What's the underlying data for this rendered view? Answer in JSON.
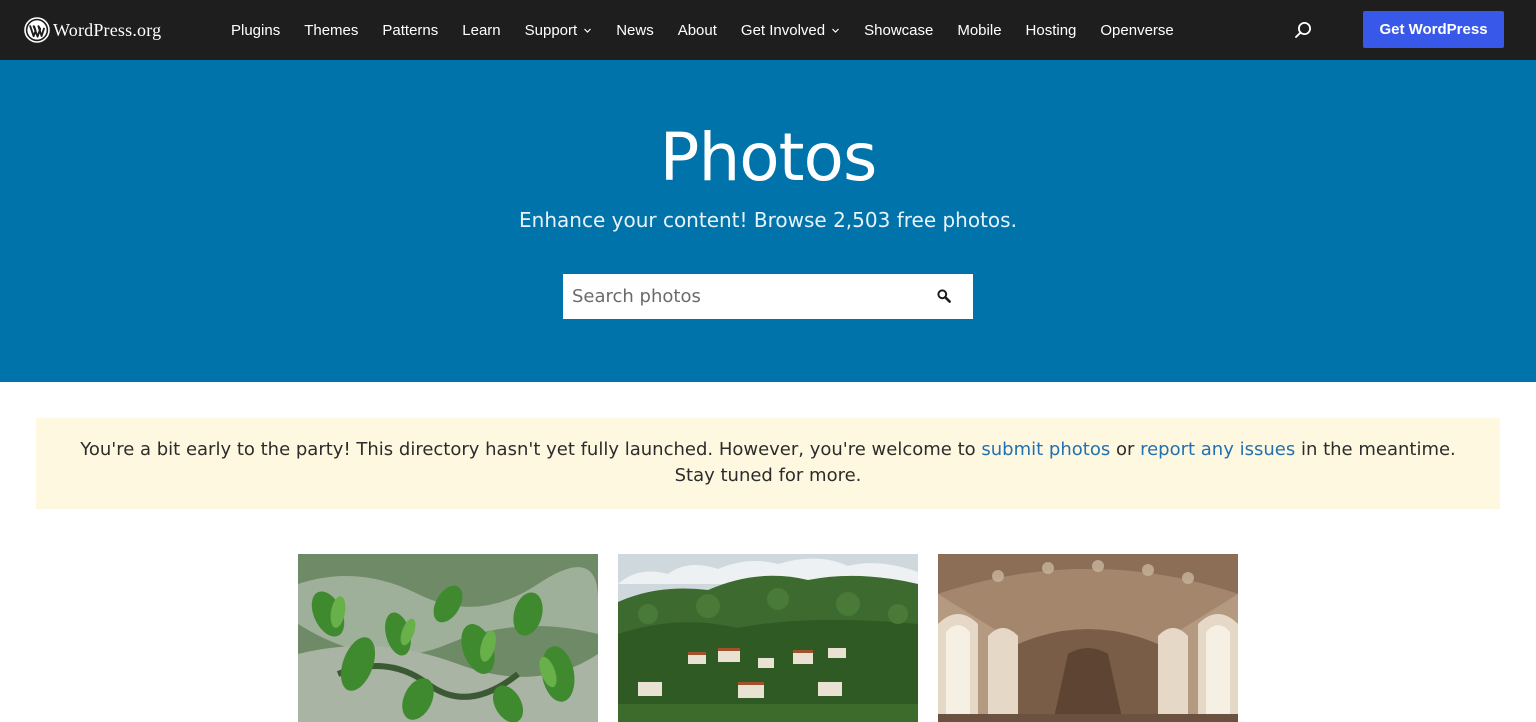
{
  "header": {
    "logo_text": "WordPress.org",
    "nav": [
      {
        "label": "Plugins",
        "dropdown": false
      },
      {
        "label": "Themes",
        "dropdown": false
      },
      {
        "label": "Patterns",
        "dropdown": false
      },
      {
        "label": "Learn",
        "dropdown": false
      },
      {
        "label": "Support",
        "dropdown": true
      },
      {
        "label": "News",
        "dropdown": false
      },
      {
        "label": "About",
        "dropdown": false
      },
      {
        "label": "Get Involved",
        "dropdown": true
      },
      {
        "label": "Showcase",
        "dropdown": false
      },
      {
        "label": "Mobile",
        "dropdown": false
      },
      {
        "label": "Hosting",
        "dropdown": false
      },
      {
        "label": "Openverse",
        "dropdown": false
      }
    ],
    "search_icon": "search-icon",
    "cta_label": "Get WordPress"
  },
  "hero": {
    "title": "Photos",
    "subtitle": "Enhance your content! Browse 2,503 free photos.",
    "search_placeholder": "Search photos",
    "search_value": ""
  },
  "notice": {
    "text_before": "You're a bit early to the party! This directory hasn't yet fully launched. However, you're welcome to ",
    "link1": "submit photos",
    "text_middle": " or ",
    "link2": "report any issues",
    "text_after": " in the meantime. Stay tuned for more."
  },
  "photos": [
    {
      "subject": "green plants in stream"
    },
    {
      "subject": "forested hillside with village"
    },
    {
      "subject": "ornate arched corridor"
    }
  ],
  "colors": {
    "topbar": "#1e1e1e",
    "hero": "#0073aa",
    "accent_button": "#3858e9",
    "notice_bg": "#fef8e0",
    "link": "#2271b1"
  }
}
